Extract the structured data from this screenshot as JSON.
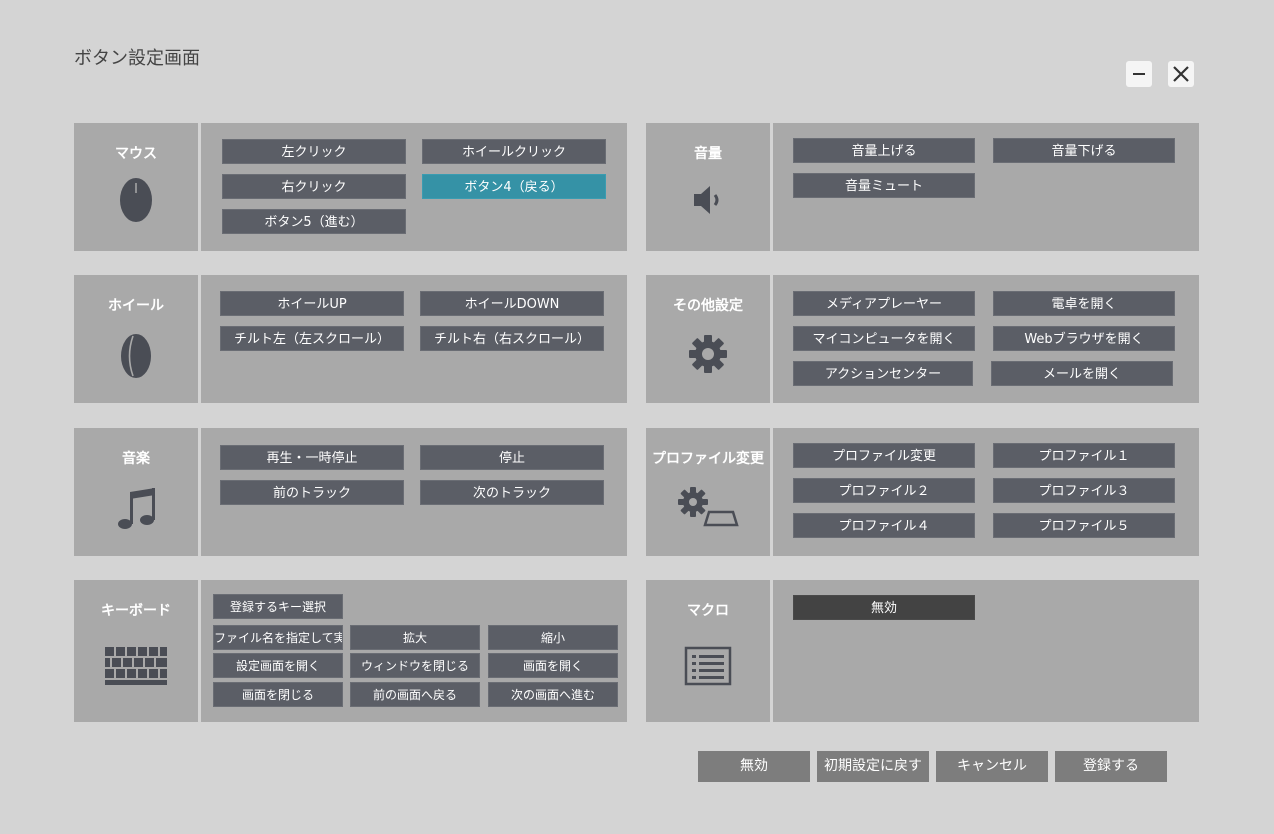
{
  "window": {
    "title": "ボタン設定画面",
    "minimize_icon": "minus-icon",
    "close_icon": "close-icon"
  },
  "panels": {
    "mouse": {
      "label": "マウス",
      "icon": "mouse-icon",
      "buttons": [
        "左クリック",
        "ホイールクリック",
        "右クリック",
        "ボタン4（戻る）",
        "ボタン5（進む）"
      ]
    },
    "volume": {
      "label": "音量",
      "icon": "speaker-icon",
      "buttons": [
        "音量上げる",
        "音量下げる",
        "音量ミュート"
      ]
    },
    "wheel": {
      "label": "ホイール",
      "icon": "wheel-icon",
      "buttons": [
        "ホイールUP",
        "ホイールDOWN",
        "チルト左（左スクロール）",
        "チルト右（右スクロール）"
      ]
    },
    "other": {
      "label": "その他設定",
      "icon": "gear-icon",
      "buttons": [
        "メディアプレーヤー",
        "電卓を開く",
        "マイコンピュータを開く",
        "Webブラウザを開く",
        "アクションセンター",
        "メールを開く"
      ]
    },
    "music": {
      "label": "音楽",
      "icon": "music-note-icon",
      "buttons": [
        "再生・一時停止",
        "停止",
        "前のトラック",
        "次のトラック"
      ]
    },
    "profile": {
      "label": "プロファイル変更",
      "icon": "profile-switch-icon",
      "buttons": [
        "プロファイル変更",
        "プロファイル１",
        "プロファイル２",
        "プロファイル３",
        "プロファイル４",
        "プロファイル５"
      ]
    },
    "keyboard": {
      "label": "キーボード",
      "icon": "keyboard-icon",
      "buttons": [
        "登録するキー選択",
        "ファイル名を指定して実行",
        "拡大",
        "縮小",
        "設定画面を開く",
        "ウィンドウを閉じる",
        "画面を開く",
        "画面を閉じる",
        "前の画面へ戻る",
        "次の画面へ進む"
      ]
    },
    "macro": {
      "label": "マクロ",
      "icon": "list-icon",
      "buttons": [
        "無効"
      ]
    }
  },
  "footer": {
    "disable": "無効",
    "reset": "初期設定に戻す",
    "cancel": "キャンセル",
    "register": "登録する"
  },
  "colors": {
    "background": "#d4d4d4",
    "panel": "#a9a9a9",
    "button": "#5b5e66",
    "selected": "#3592a6",
    "footer_button": "#7d7d7d"
  }
}
